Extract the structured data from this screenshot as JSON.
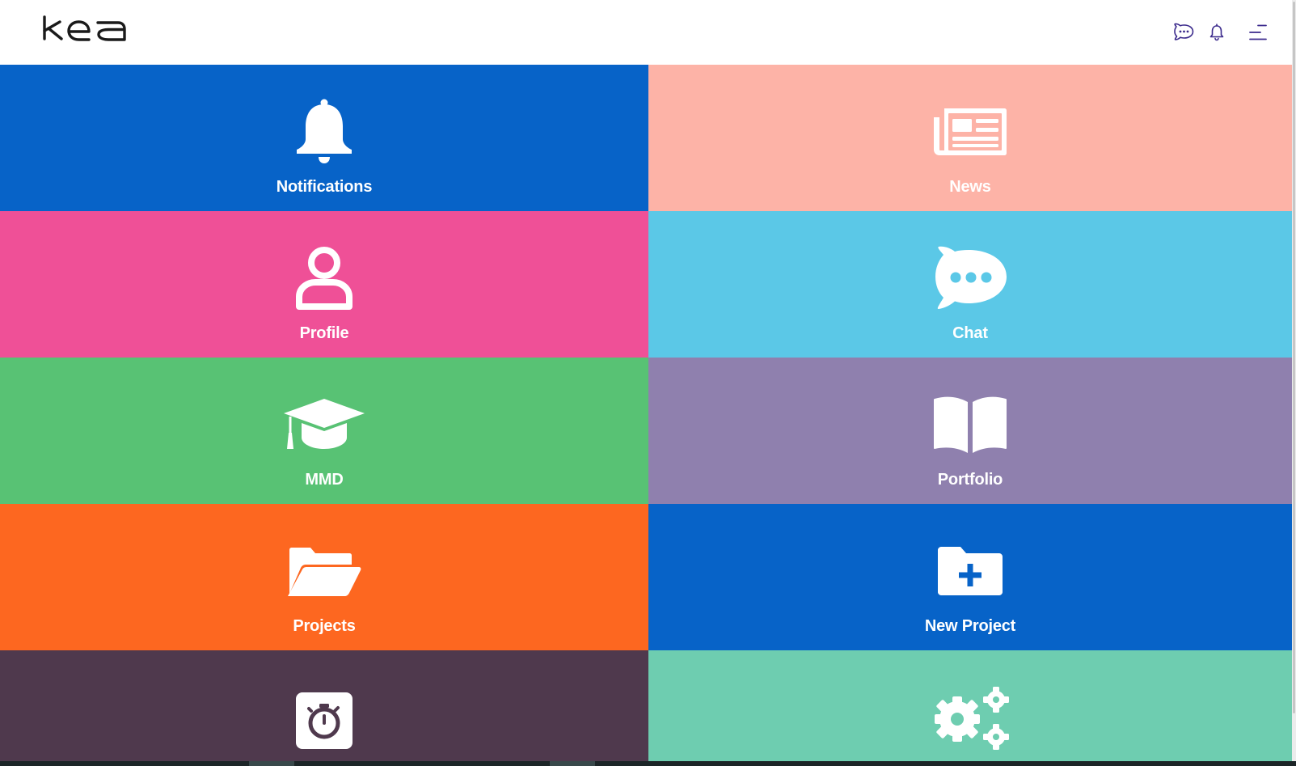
{
  "header": {
    "logo_text": "kea",
    "icons": [
      "chat-icon",
      "bell-icon",
      "menu-icon"
    ],
    "icon_color": "#3b2a8c"
  },
  "tiles": [
    {
      "label": "Notifications",
      "icon": "bell-icon",
      "color": "#0763c8"
    },
    {
      "label": "News",
      "icon": "newspaper-icon",
      "color": "#fdb3a7"
    },
    {
      "label": "Profile",
      "icon": "user-icon",
      "color": "#ef5097"
    },
    {
      "label": "Chat",
      "icon": "chat-bubble-icon",
      "color": "#5bc8e7"
    },
    {
      "label": "MMD",
      "icon": "graduation-cap-icon",
      "color": "#58c274"
    },
    {
      "label": "Portfolio",
      "icon": "open-book-icon",
      "color": "#8f80ae"
    },
    {
      "label": "Projects",
      "icon": "folder-open-icon",
      "color": "#fd6720"
    },
    {
      "label": "New Project",
      "icon": "folder-plus-icon",
      "color": "#0763c8"
    },
    {
      "label": "",
      "icon": "stopwatch-icon",
      "color": "#4f394d"
    },
    {
      "label": "",
      "icon": "gears-icon",
      "color": "#6ecdb0"
    }
  ]
}
